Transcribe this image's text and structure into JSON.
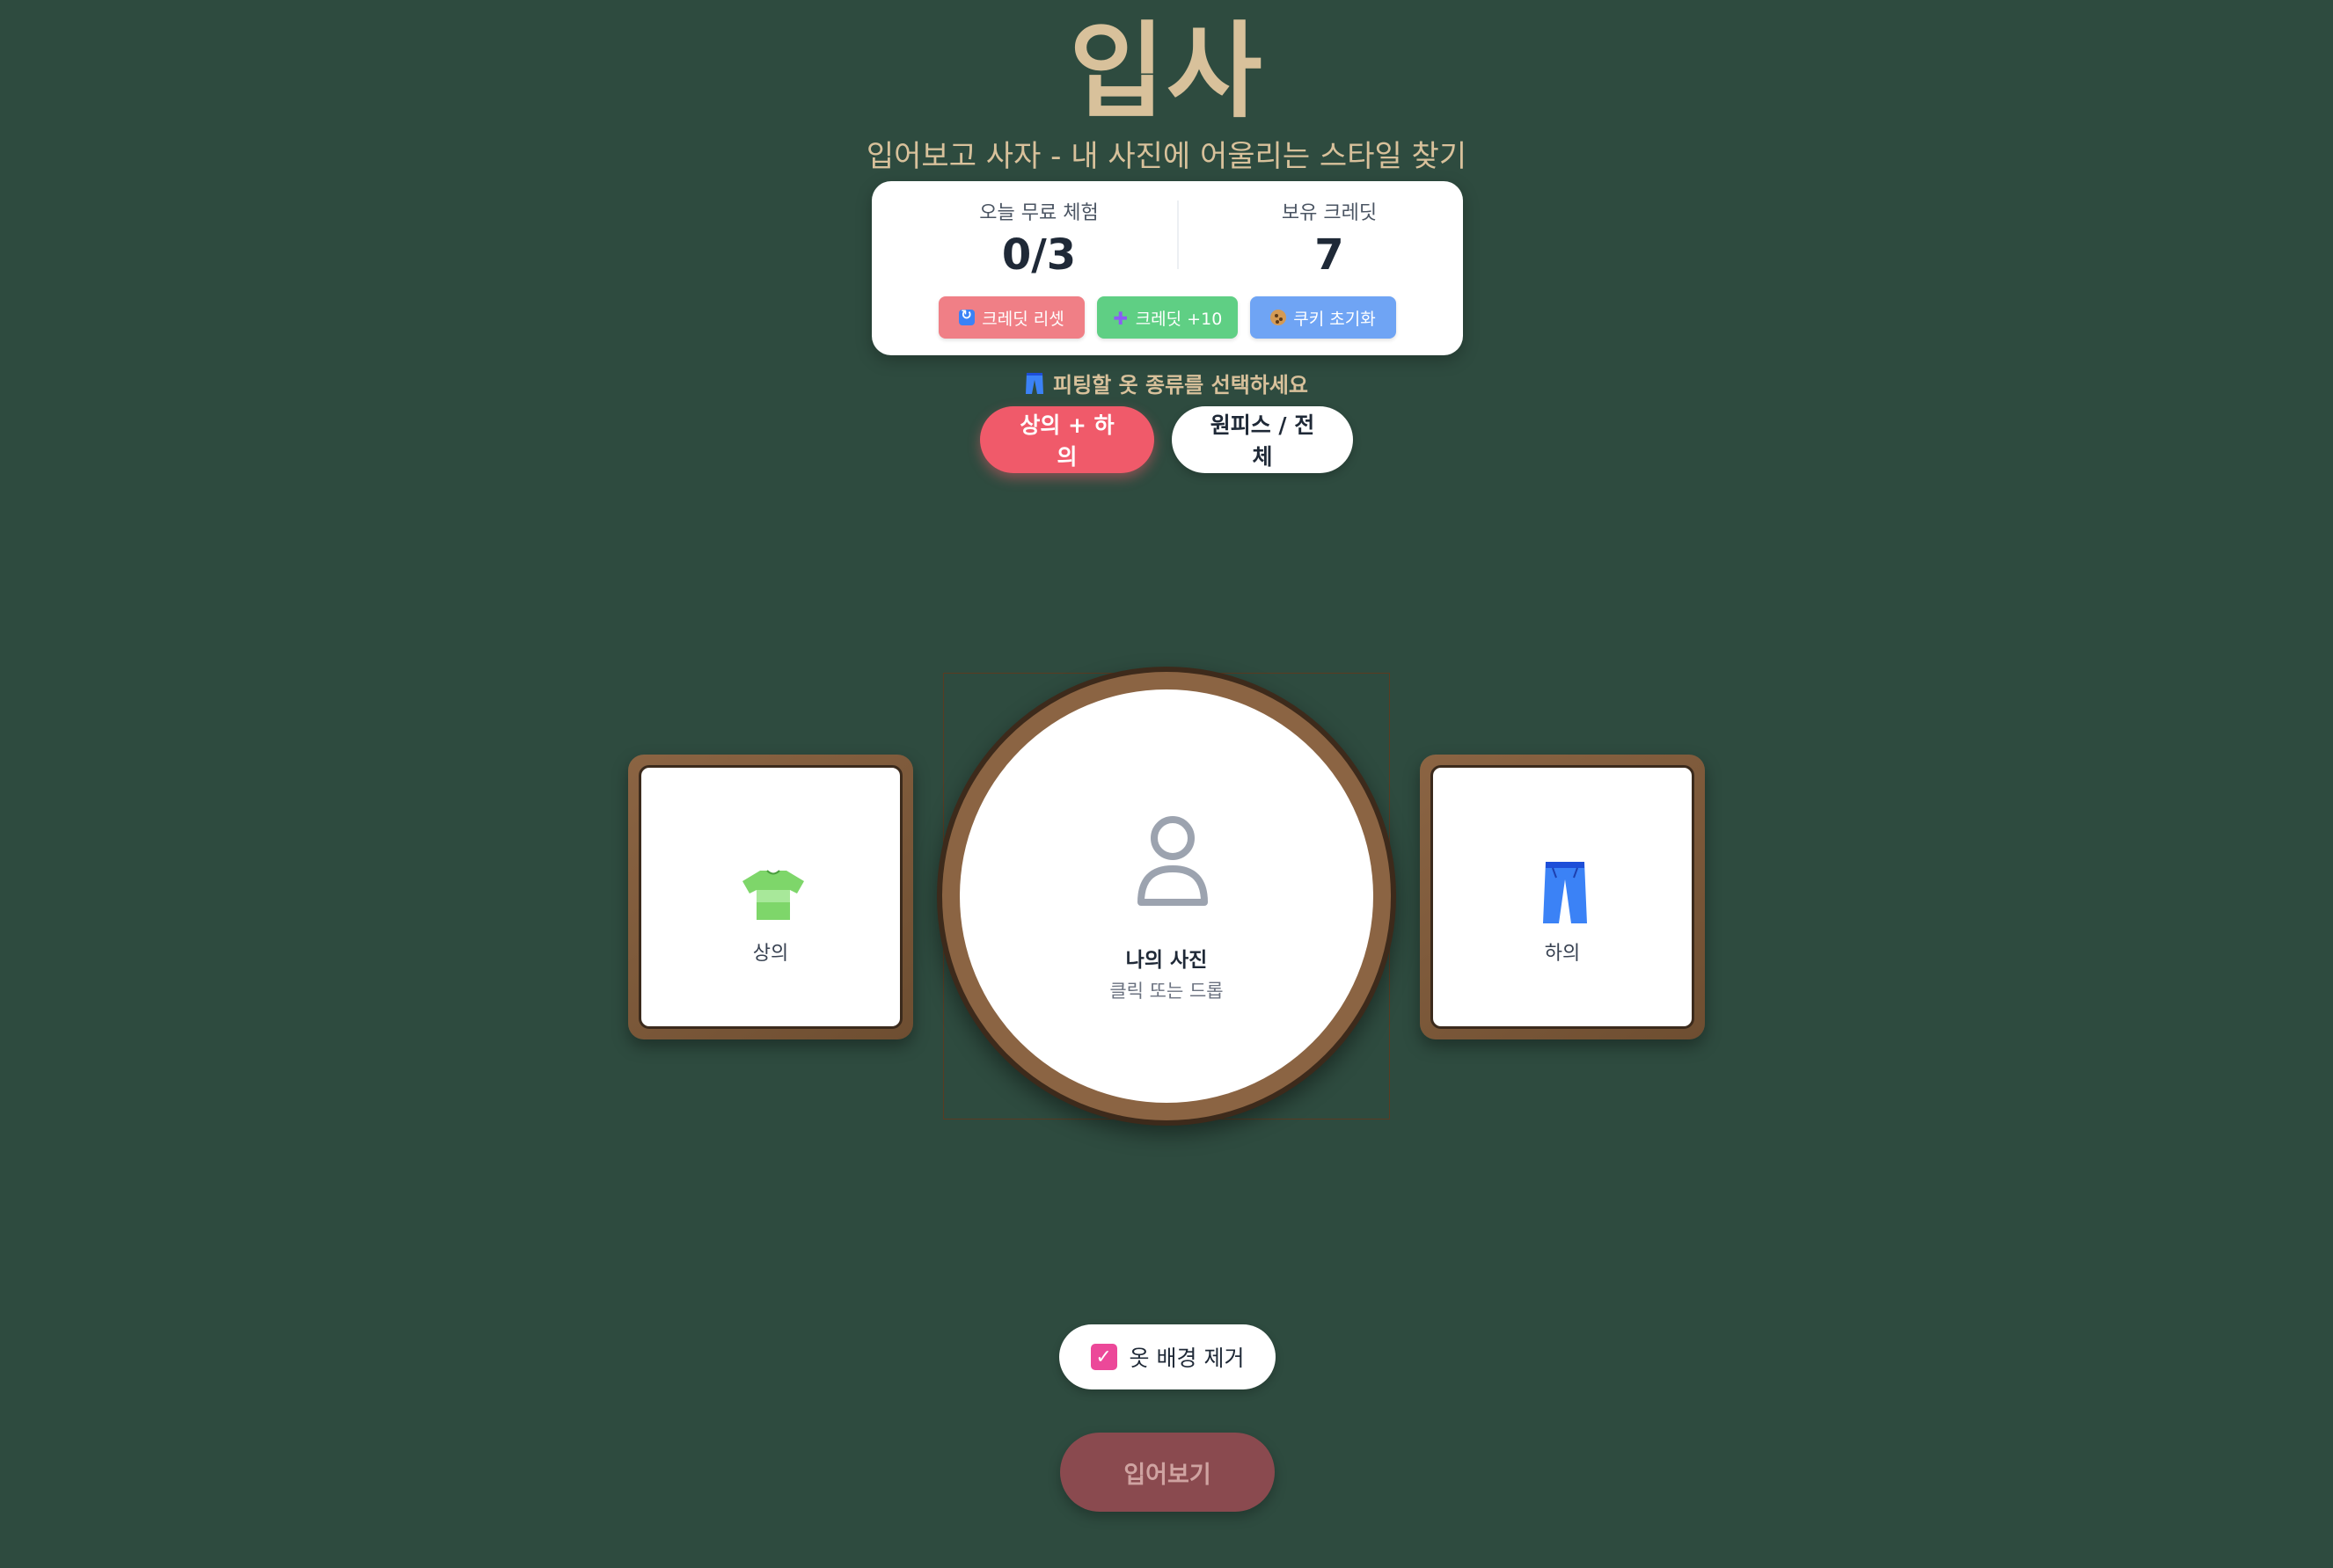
{
  "header": {
    "title": "입사",
    "subtitle": "입어보고 사자 - 내 사진에 어울리는 스타일 찾기"
  },
  "credits": {
    "free_label": "오늘 무료 체험",
    "free_value": "0/3",
    "owned_label": "보유 크레딧",
    "owned_value": "7",
    "buttons": {
      "reset": "크레딧 리셋",
      "plus": "크레딧 +10",
      "cookie": "쿠키 초기화"
    }
  },
  "type_select": {
    "heading": "피팅할 옷 종류를 선택하세요",
    "options": [
      "상의 + 하의",
      "원피스 / 전체"
    ],
    "selected": "상의 + 하의"
  },
  "frames": {
    "top_label": "상의",
    "bottom_label": "하의",
    "photo_title": "나의 사진",
    "photo_hint": "클릭 또는 드롭"
  },
  "options": {
    "bg_remove_label": "옷 배경 제거",
    "bg_remove_checked": true
  },
  "actions": {
    "tryon": "입어보기"
  },
  "colors": {
    "background": "#2e4b3f",
    "title": "#d8c19b",
    "active_type": "#f05a6a",
    "tryon_button": "#8a4a4f",
    "checkbox": "#ec4899"
  }
}
